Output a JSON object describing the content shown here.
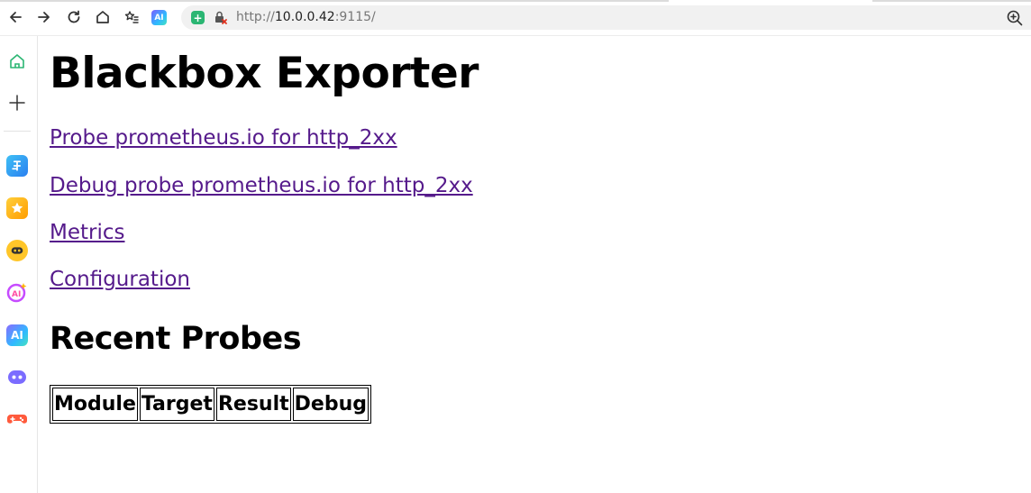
{
  "browser": {
    "url_scheme": "http://",
    "url_host": "10.0.0.42",
    "url_port": ":9115/",
    "ai_badge": "AI",
    "toolbar_icons": [
      "back-icon",
      "forward-icon",
      "reload-icon",
      "home-icon",
      "favorites-icon",
      "ai-assistant-icon"
    ],
    "sidebar_icons": [
      "home-icon",
      "add-icon",
      "app-icon-1",
      "app-icon-favorites",
      "app-icon-3",
      "app-icon-ai-writer",
      "app-icon-ai",
      "app-icon-bot",
      "app-icon-game"
    ]
  },
  "page": {
    "title": "Blackbox Exporter",
    "links": [
      "Probe prometheus.io for http_2xx",
      "Debug probe prometheus.io for http_2xx",
      "Metrics",
      "Configuration"
    ],
    "recent_heading": "Recent Probes",
    "table_headers": [
      "Module",
      "Target",
      "Result",
      "Debug"
    ]
  },
  "colors": {
    "link_visited": "#551a8b",
    "heading": "#000000"
  }
}
